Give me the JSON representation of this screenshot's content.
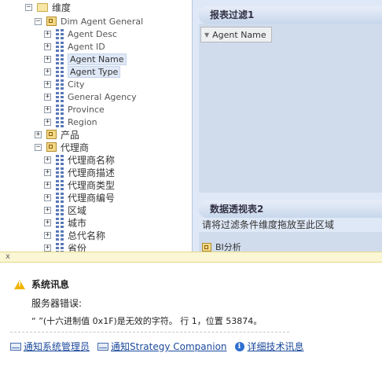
{
  "tree": {
    "items": [
      {
        "label": "维度",
        "toggle": "−",
        "icon": "folder-icon",
        "cn": true
      },
      {
        "label": "Dim Agent General",
        "toggle": "−",
        "icon": "dimension-icon"
      },
      {
        "label": "Agent Desc",
        "toggle": "+",
        "icon": "attribute-icon"
      },
      {
        "label": "Agent ID",
        "toggle": "+",
        "icon": "attribute-icon"
      },
      {
        "label": "Agent Name",
        "toggle": "+",
        "icon": "attribute-icon",
        "selected": true
      },
      {
        "label": "Agent Type",
        "toggle": "+",
        "icon": "attribute-icon",
        "selected": true
      },
      {
        "label": "City",
        "toggle": "+",
        "icon": "attribute-icon"
      },
      {
        "label": "General Agency",
        "toggle": "+",
        "icon": "attribute-icon"
      },
      {
        "label": "Province",
        "toggle": "+",
        "icon": "attribute-icon"
      },
      {
        "label": "Region",
        "toggle": "+",
        "icon": "attribute-icon"
      },
      {
        "label": "产品",
        "toggle": "+",
        "icon": "dimension-icon",
        "cn": true
      },
      {
        "label": "代理商",
        "toggle": "−",
        "icon": "dimension-icon",
        "cn": true
      },
      {
        "label": "代理商名称",
        "toggle": "+",
        "icon": "attribute-icon",
        "cn": true
      },
      {
        "label": "代理商描述",
        "toggle": "+",
        "icon": "attribute-icon",
        "cn": true
      },
      {
        "label": "代理商类型",
        "toggle": "+",
        "icon": "attribute-icon",
        "cn": true
      },
      {
        "label": "代理商编号",
        "toggle": "+",
        "icon": "attribute-icon",
        "cn": true
      },
      {
        "label": "区域",
        "toggle": "+",
        "icon": "attribute-icon",
        "cn": true
      },
      {
        "label": "城市",
        "toggle": "+",
        "icon": "attribute-icon",
        "cn": true
      },
      {
        "label": "总代名称",
        "toggle": "+",
        "icon": "attribute-icon",
        "cn": true
      },
      {
        "label": "省份",
        "toggle": "+",
        "icon": "attribute-icon",
        "cn": true
      }
    ]
  },
  "report_filter": {
    "title": "报表过滤1",
    "chip_label": "Agent Name"
  },
  "pivot": {
    "title": "数据透视表2",
    "hint": "请将过滤条件维度拖放至此区域",
    "chip_label": "BI分析"
  },
  "message_bar": {
    "close_label": "x"
  },
  "error": {
    "title": "系统讯息",
    "subtitle": "服务器错误:",
    "detail": "“ ”(十六进制值 0x1F)是无效的字符。 行 1，位置 53874。",
    "links": [
      {
        "label": "通知系统管理员",
        "icon": "mail-icon"
      },
      {
        "label": "通知Strategy Companion",
        "icon": "mail-icon"
      },
      {
        "label": "详细技术讯息",
        "icon": "info-icon"
      }
    ]
  }
}
